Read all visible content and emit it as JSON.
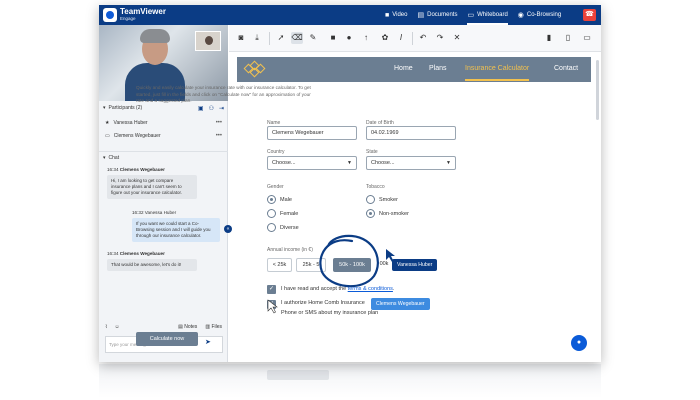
{
  "app": {
    "name": "TeamViewer",
    "sub": "Engage"
  },
  "topnav": [
    {
      "label": "Video",
      "icon": "video-icon",
      "glyph": "■"
    },
    {
      "label": "Documents",
      "icon": "document-icon",
      "glyph": "▤"
    },
    {
      "label": "Whiteboard",
      "icon": "whiteboard-icon",
      "glyph": "▭"
    },
    {
      "label": "Co-Browsing",
      "icon": "eye-icon",
      "glyph": "◉"
    }
  ],
  "active_tab": "Whiteboard",
  "participants": {
    "header": "Participants (2)",
    "list": [
      "Vanessa Huber",
      "Clemens Wegebauer"
    ]
  },
  "chat": {
    "header": "Chat",
    "messages": [
      {
        "time": "16:34",
        "name": "Clemens Wegebauer",
        "text": "Hi, I am looking to get compare insurance plans and I can't seem to figure out your insurance calculator."
      },
      {
        "time": "16:32",
        "name": "Vanessa Huber",
        "text": "If you want we could start a Co-Browsing session and I will guide you through our insurance calculator."
      },
      {
        "time": "16:34",
        "name": "Clemens Wegebauer",
        "text": "That would be awesome, let's do it!"
      }
    ],
    "notes_label": "Notes",
    "files_label": "Files",
    "input_placeholder": "Type your message here..."
  },
  "site": {
    "nav": [
      "Home",
      "Plans",
      "Insurance Calculator",
      "Contact"
    ],
    "active": "Insurance Calculator",
    "intro": "Quickly and easily calculate your insurance rate with our insurance calculator. To get started, just fill in the fields and click on \"Calculate now\" for an approximation of your rate and a suggested plan.",
    "name_label": "Name",
    "name_value": "Clemens Wegebauer",
    "dob_label": "Date of Birth",
    "dob_value": "04.02.1969",
    "country_label": "Country",
    "country_value": "Choose...",
    "state_label": "State",
    "state_value": "Choose...",
    "gender_label": "Gender",
    "gender_options": [
      "Male",
      "Female",
      "Diverse"
    ],
    "gender_selected": "Male",
    "tobacco_label": "Tobacco",
    "tobacco_options": [
      "Smoker",
      "Non-smoker"
    ],
    "tobacco_selected": "Non-smoker",
    "income_label": "Annual income (in €)",
    "income_options": [
      "< 25k",
      "25k - 5",
      "50k - 100k",
      "00k"
    ],
    "income_selected": "50k - 100k",
    "consent1_pre": "I have read and accept the ",
    "consent1_link": "terms & conditions",
    "consent2": "I authorize Home Comb Insurance",
    "consent2_b": "Phone or SMS about my insurance plan",
    "calc_button": "Calculate now"
  },
  "cursors": {
    "vanessa": "Vanessa Huber",
    "clemens": "Clemens Wegebauer"
  },
  "colors": {
    "brand": "#0b3c85",
    "accent": "#f2c14e",
    "site_nav": "#6b7e92",
    "endcall": "#e9423b"
  }
}
